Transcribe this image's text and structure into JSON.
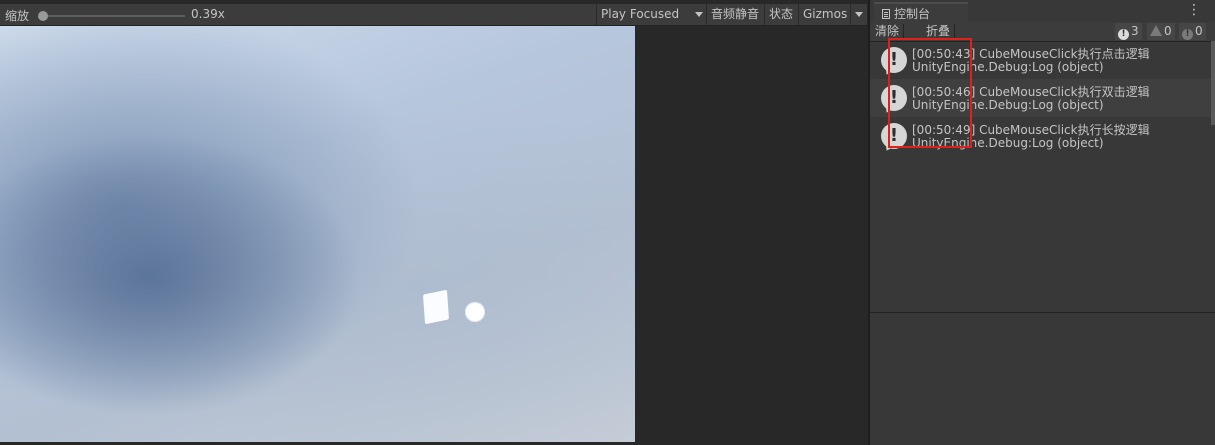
{
  "game": {
    "zoom_label": "缩放",
    "zoom_value": "0.39x",
    "zoom_fraction": 0.02,
    "play_mode": "Play Focused",
    "mute_label": "音频静音",
    "stats_label": "状态",
    "gizmos_label": "Gizmos"
  },
  "console": {
    "tab_title": "控制台",
    "clear_label": "清除",
    "collapse_label": "折叠",
    "counts": {
      "info": "3",
      "warn": "0",
      "error": "0"
    },
    "logs": [
      {
        "line1": "[00:50:43] CubeMouseClick执行点击逻辑",
        "line2": "UnityEngine.Debug:Log (object)"
      },
      {
        "line1": "[00:50:46] CubeMouseClick执行双击逻辑",
        "line2": "UnityEngine.Debug:Log (object)"
      },
      {
        "line1": "[00:50:49] CubeMouseClick执行长按逻辑",
        "line2": "UnityEngine.Debug:Log (object)"
      }
    ]
  },
  "colors": {
    "panel_bg": "#383838",
    "toolbar_bg": "#3c3c3c",
    "highlight": "#e0201b"
  }
}
